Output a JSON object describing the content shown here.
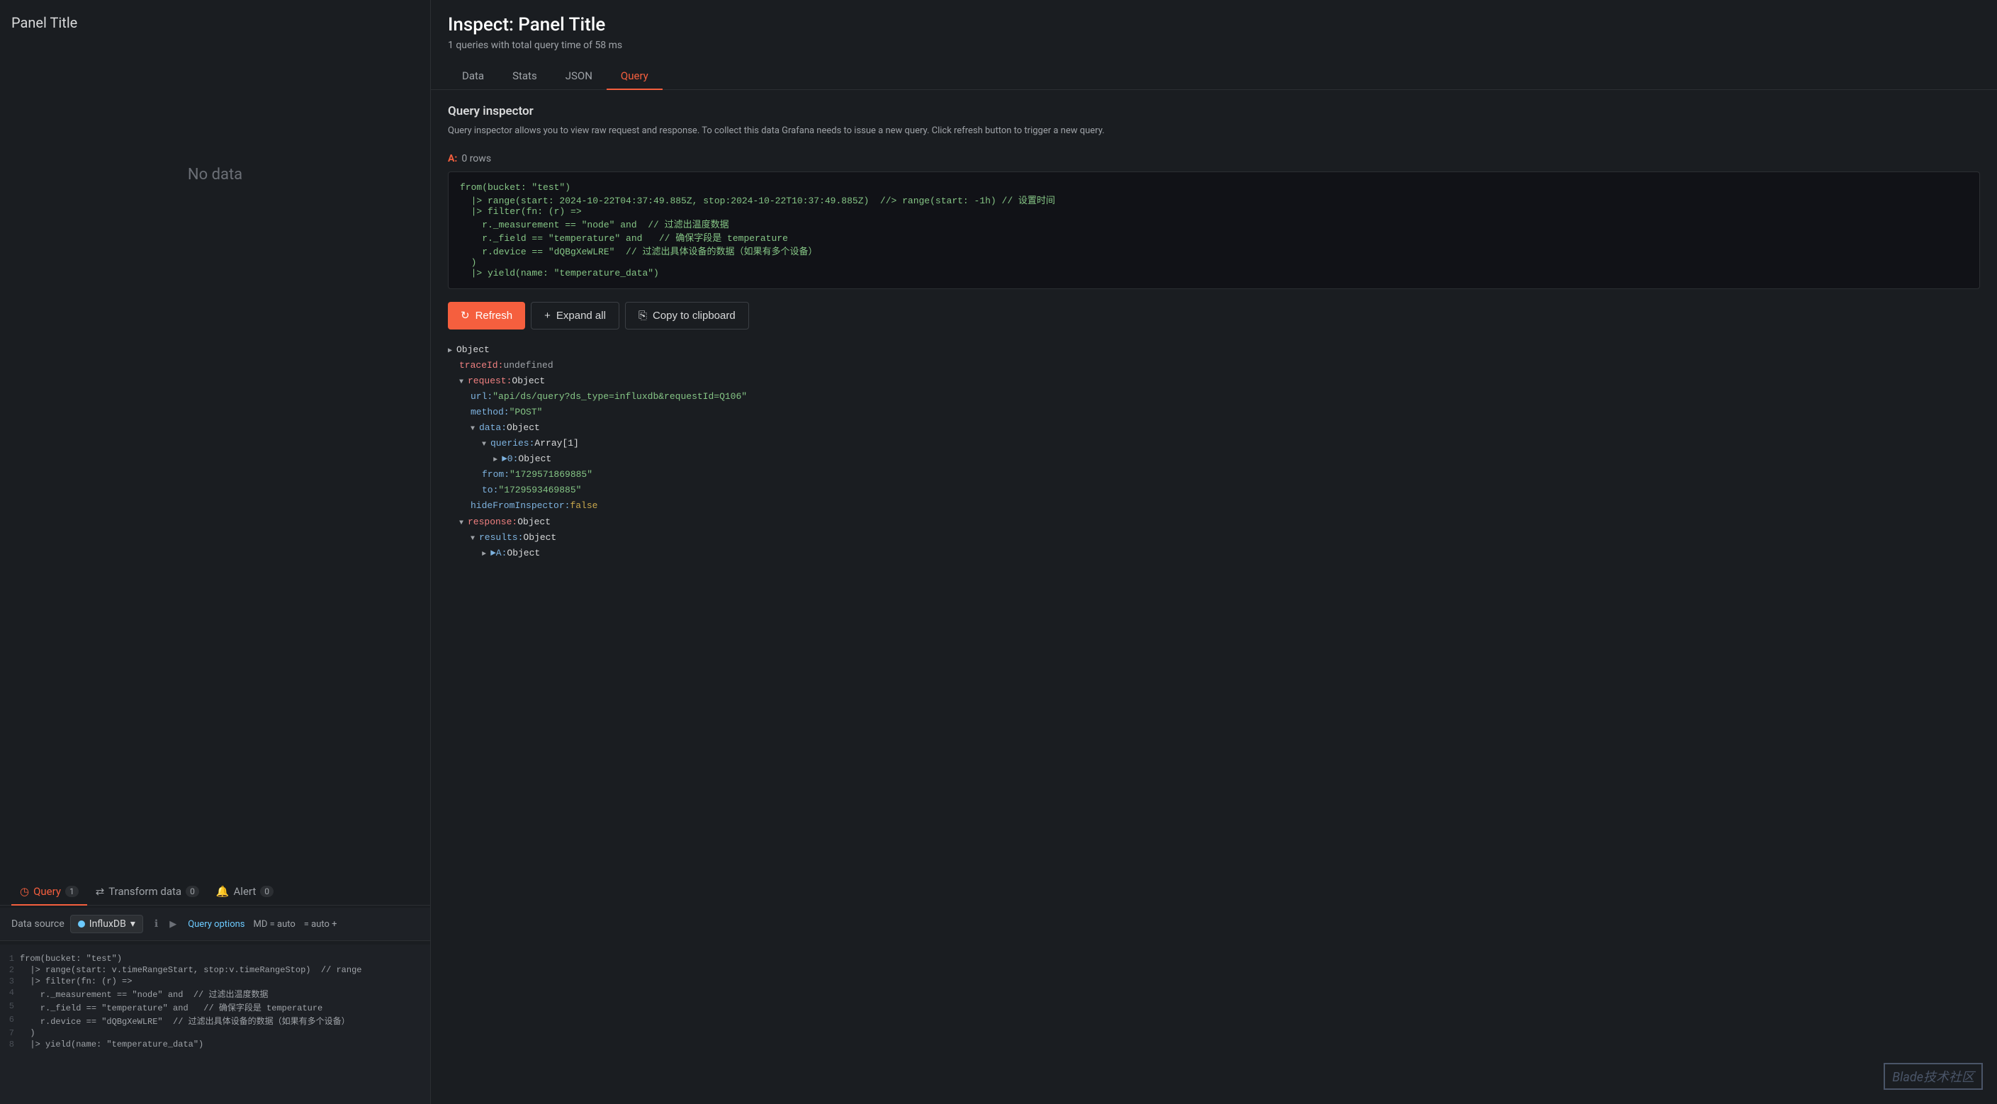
{
  "left": {
    "panel_title": "Panel Title",
    "no_data": "No data",
    "tabs": [
      {
        "id": "query",
        "label": "Query",
        "badge": "1",
        "active": true,
        "icon": "◷"
      },
      {
        "id": "transform",
        "label": "Transform data",
        "badge": "0",
        "active": false,
        "icon": "⇄"
      },
      {
        "id": "alert",
        "label": "Alert",
        "badge": "0",
        "active": false,
        "icon": "🔔"
      }
    ],
    "datasource_label": "Data source",
    "datasource_name": "InfluxDB",
    "query_options": "Query options",
    "md_auto": "MD = auto",
    "code_lines": [
      {
        "num": "1",
        "text": "from(bucket: \"test\")"
      },
      {
        "num": "2",
        "text": "  |> range(start: v.timeRangeStart, stop:v.timeRangeStop)  // range"
      },
      {
        "num": "3",
        "text": "  |> filter(fn: (r) =>"
      },
      {
        "num": "4",
        "text": "    r._measurement == \"node\" and  // 过滤出温度数据"
      },
      {
        "num": "5",
        "text": "    r._field == \"temperature\" and   // 确保字段是 temperature"
      },
      {
        "num": "6",
        "text": "    r.device == \"dQBgXeWLRE\"  // 过滤出具体设备的数据（如果有多个设备）"
      },
      {
        "num": "7",
        "text": "  )"
      },
      {
        "num": "8",
        "text": "  |> yield(name: \"temperature_data\")"
      }
    ]
  },
  "right": {
    "title": "Inspect: Panel Title",
    "subtitle": "1 queries with total query time of 58 ms",
    "tabs": [
      {
        "label": "Data",
        "active": false
      },
      {
        "label": "Stats",
        "active": false
      },
      {
        "label": "JSON",
        "active": false
      },
      {
        "label": "Query",
        "active": true
      }
    ],
    "section_title": "Query inspector",
    "section_desc": "Query inspector allows you to view raw request and response. To collect this data Grafana needs to issue a new query. Click refresh button to trigger a new query.",
    "query_section": {
      "label": "A:",
      "rows": "0 rows"
    },
    "query_code": "from(bucket: \"test\")\n  |> range(start: 2024-10-22T04:37:49.885Z, stop:2024-10-22T10:37:49.885Z)  //> range(start: -1h) // 设置时间\n  |> filter(fn: (r) =>\n    r._measurement == \"node\" and  // 过滤出温度数据\n    r._field == \"temperature\" and   // 确保字段是 temperature\n    r.device == \"dQBgXeWLRE\"  // 过滤出具体设备的数据（如果有多个设备）\n  )\n  |> yield(name: \"temperature_data\")",
    "buttons": {
      "refresh": "Refresh",
      "expand_all": "Expand all",
      "copy": "Copy to clipboard"
    },
    "json_tree": [
      {
        "indent": 0,
        "triangle": "▶",
        "content": "Object",
        "type": "plain"
      },
      {
        "indent": 1,
        "content": "traceId:",
        "key_type": "orange",
        "value": " undefined",
        "value_type": "undefined"
      },
      {
        "indent": 1,
        "triangle": "▼",
        "content": "request:",
        "key_type": "orange",
        "value": " Object",
        "value_type": "plain"
      },
      {
        "indent": 2,
        "content": "url:",
        "key_type": "key",
        "value": " \"api/ds/query?ds_type=influxdb&requestId=Q106\"",
        "value_type": "string"
      },
      {
        "indent": 2,
        "content": "method:",
        "key_type": "key",
        "value": " \"POST\"",
        "value_type": "string"
      },
      {
        "indent": 2,
        "triangle": "▼",
        "content": "data:",
        "key_type": "key",
        "value": " Object",
        "value_type": "plain"
      },
      {
        "indent": 3,
        "triangle": "▼",
        "content": "queries:",
        "key_type": "key",
        "value": " Array[1]",
        "value_type": "plain"
      },
      {
        "indent": 4,
        "triangle": "▶",
        "content": "►0:",
        "key_type": "key",
        "value": " Object",
        "value_type": "plain"
      },
      {
        "indent": 3,
        "content": "from:",
        "key_type": "key",
        "value": " \"1729571869885\"",
        "value_type": "string"
      },
      {
        "indent": 3,
        "content": "to:",
        "key_type": "key",
        "value": " \"1729593469885\"",
        "value_type": "string"
      },
      {
        "indent": 2,
        "content": "hideFromInspector:",
        "key_type": "key",
        "value": " false",
        "value_type": "bool"
      },
      {
        "indent": 1,
        "triangle": "▼",
        "content": "response:",
        "key_type": "orange",
        "value": " Object",
        "value_type": "plain"
      },
      {
        "indent": 2,
        "triangle": "▼",
        "content": "results:",
        "key_type": "key",
        "value": " Object",
        "value_type": "plain"
      },
      {
        "indent": 3,
        "triangle": "▶",
        "content": "►A:",
        "key_type": "key",
        "value": " Object",
        "value_type": "plain"
      }
    ],
    "watermark": "Blade技术社区"
  }
}
